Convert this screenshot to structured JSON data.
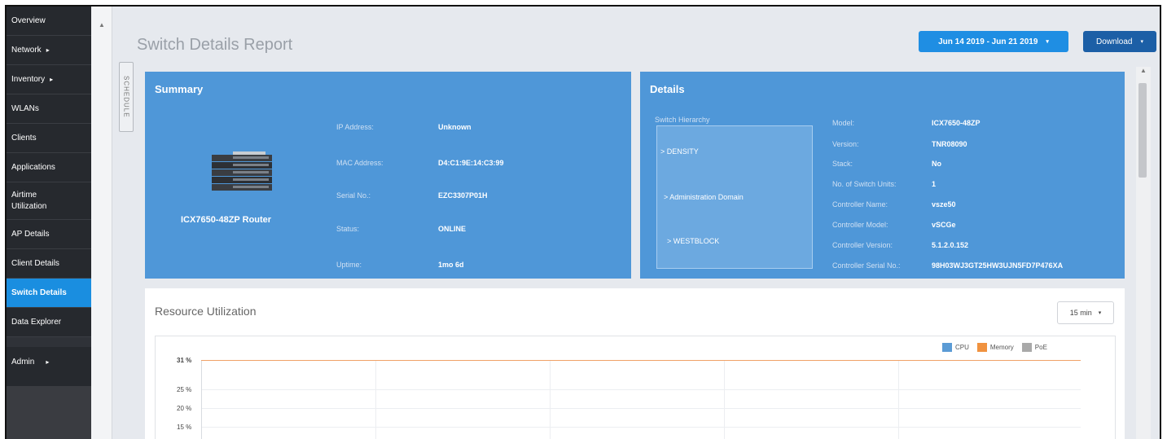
{
  "sidebar": {
    "items": [
      {
        "label": "Overview"
      },
      {
        "label": "Network",
        "caret": "▸"
      },
      {
        "label": "Inventory",
        "caret": "▸"
      },
      {
        "label": "WLANs"
      },
      {
        "label": "Clients"
      },
      {
        "label": "Applications"
      },
      {
        "label": "Airtime Utilization"
      },
      {
        "label": "AP Details"
      },
      {
        "label": "Client Details"
      },
      {
        "label": "Switch Details"
      },
      {
        "label": "Data Explorer"
      },
      {
        "label": "Admin",
        "caret": "▸"
      }
    ]
  },
  "header": {
    "title": "Switch Details Report",
    "date_range": "Jun 14 2019 - Jun 21 2019",
    "download": "Download",
    "caret": "▾",
    "schedule": "SCHEDULE"
  },
  "summary": {
    "title": "Summary",
    "device_name": "ICX7650-48ZP Router",
    "fields": [
      {
        "label": "IP Address:",
        "value": "Unknown"
      },
      {
        "label": "MAC Address:",
        "value": "D4:C1:9E:14:C3:99"
      },
      {
        "label": "Serial No.:",
        "value": "EZC3307P01H"
      },
      {
        "label": "Status:",
        "value": "ONLINE"
      },
      {
        "label": "Uptime:",
        "value": "1mo 6d"
      }
    ]
  },
  "details": {
    "title": "Details",
    "hierarchy_label": "Switch Hierarchy",
    "hierarchy": [
      "> DENSITY",
      "> Administration Domain",
      "> WESTBLOCK"
    ],
    "fields": [
      {
        "label": "Model:",
        "value": "ICX7650-48ZP"
      },
      {
        "label": "Version:",
        "value": "TNR08090"
      },
      {
        "label": "Stack:",
        "value": "No"
      },
      {
        "label": "No. of Switch Units:",
        "value": "1"
      },
      {
        "label": "Controller Name:",
        "value": "vsze50"
      },
      {
        "label": "Controller Model:",
        "value": "vSCGe"
      },
      {
        "label": "Controller Version:",
        "value": "5.1.2.0.152"
      },
      {
        "label": "Controller Serial No.:",
        "value": "98H03WJ3GT25HW3UJN5FD7P476XA"
      }
    ]
  },
  "resource": {
    "title": "Resource Utilization",
    "interval": "15 min",
    "legend": [
      {
        "name": "CPU",
        "color": "#5b9bd5"
      },
      {
        "name": "Memory",
        "color": "#f0923f"
      },
      {
        "name": "PoE",
        "color": "#a9a9a9"
      }
    ],
    "yticks": [
      "31 %",
      "25 %",
      "20 %",
      "15 %"
    ]
  },
  "chart_data": {
    "type": "line",
    "title": "Resource Utilization",
    "series": [
      {
        "name": "CPU",
        "values": []
      },
      {
        "name": "Memory",
        "values": [
          31,
          31
        ]
      },
      {
        "name": "PoE",
        "values": []
      }
    ],
    "yticks": [
      "31 %",
      "25 %",
      "20 %",
      "15 %"
    ]
  }
}
